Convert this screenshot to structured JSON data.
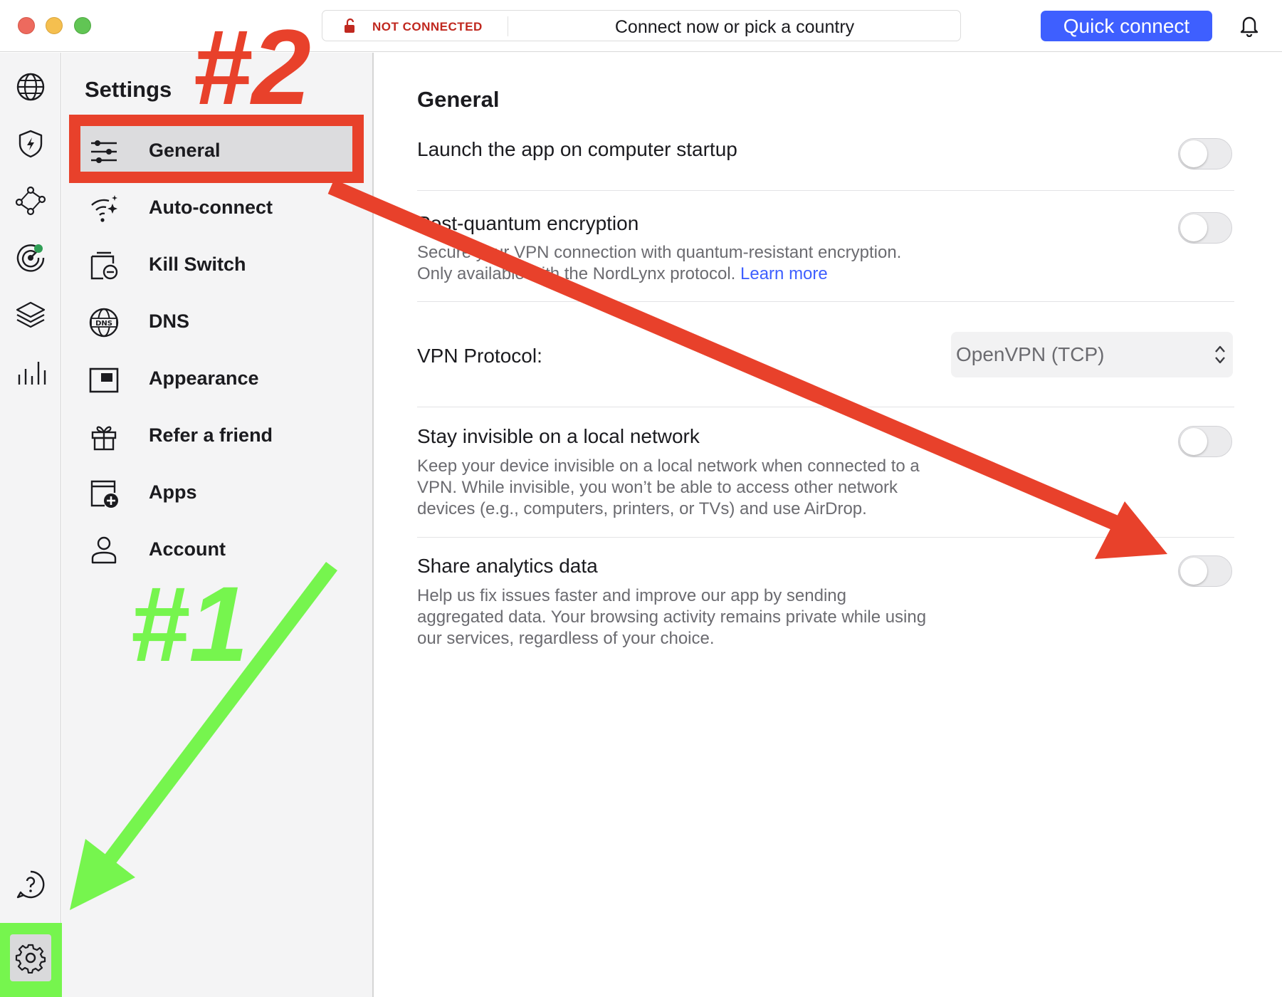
{
  "titlebar": {
    "status": "NOT CONNECTED",
    "prompt": "Connect now or pick a country",
    "quick_connect": "Quick connect"
  },
  "rail": {
    "icons": [
      "globe-icon",
      "shield-bolt-icon",
      "meshnet-icon",
      "target-icon",
      "layers-icon",
      "stats-icon",
      "help-icon",
      "gear-icon"
    ]
  },
  "settings": {
    "title": "Settings",
    "items": [
      {
        "label": "General",
        "icon": "sliders-icon",
        "active": true
      },
      {
        "label": "Auto-connect",
        "icon": "wifi-sparkle-icon"
      },
      {
        "label": "Kill Switch",
        "icon": "kill-switch-icon"
      },
      {
        "label": "DNS",
        "icon": "dns-icon"
      },
      {
        "label": "Appearance",
        "icon": "appearance-icon"
      },
      {
        "label": "Refer a friend",
        "icon": "gift-icon"
      },
      {
        "label": "Apps",
        "icon": "apps-icon"
      },
      {
        "label": "Account",
        "icon": "account-icon"
      }
    ]
  },
  "general": {
    "title": "General",
    "launch_startup": {
      "title": "Launch the app on computer startup",
      "enabled": false
    },
    "post_quantum": {
      "title": "Post-quantum encryption",
      "desc_1": "Secure your VPN connection with quantum-resistant encryption.",
      "desc_2": "Only available with the NordLynx protocol.",
      "learn_more": "Learn more",
      "enabled": false
    },
    "protocol": {
      "label": "VPN Protocol:",
      "value": "OpenVPN (TCP)"
    },
    "invisible": {
      "title": "Stay invisible on a local network",
      "desc_1": "Keep your device invisible on a local network when connected to a",
      "desc_2": "VPN. While invisible, you won’t be able to access other network",
      "desc_3": "devices (e.g., computers, printers, or TVs) and use AirDrop.",
      "enabled": false
    },
    "analytics": {
      "title": "Share analytics data",
      "desc_1": "Help us fix issues faster and improve our app by sending",
      "desc_2": "aggregated data. Your browsing activity remains private while using",
      "desc_3": "our services, regardless of your choice.",
      "enabled": false
    }
  },
  "annotations": {
    "label_1": "#1",
    "label_2": "#2",
    "color_red": "#e8412b",
    "color_green": "#76f54e"
  }
}
